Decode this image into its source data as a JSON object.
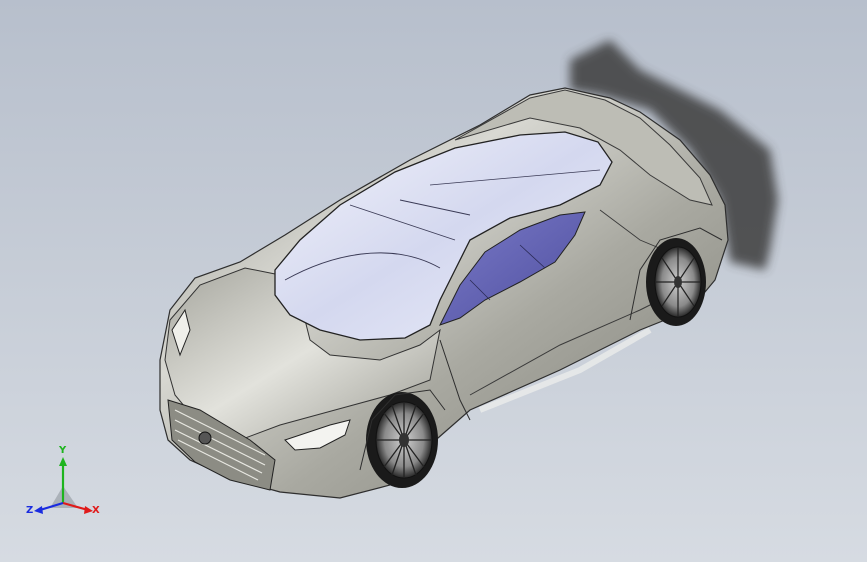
{
  "viewport": {
    "background_top": "#b7bfcc",
    "background_bottom": "#d6dbe2",
    "model": {
      "body_color": "#9a9a92",
      "body_highlight": "#ebebe6",
      "glass_color": "#dfe3f5",
      "side_window_color": "#5f5fb0",
      "shadow_color": "#3e3e3e"
    }
  },
  "triad": {
    "x_label": "X",
    "y_label": "Y",
    "z_label": "Z",
    "x_color": "#e01a1a",
    "y_color": "#1eb41e",
    "z_color": "#1a2ce0"
  }
}
